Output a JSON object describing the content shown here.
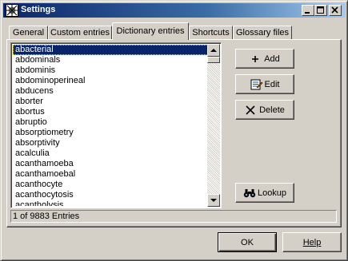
{
  "window": {
    "title": "Settings",
    "app_icon": "grid-app-icon"
  },
  "tabs": [
    {
      "label": "General",
      "active": false
    },
    {
      "label": "Custom entries",
      "active": false
    },
    {
      "label": "Dictionary entries",
      "active": true
    },
    {
      "label": "Shortcuts",
      "active": false
    },
    {
      "label": "Glossary files",
      "active": false
    }
  ],
  "entries": {
    "selected_index": 0,
    "items": [
      "abacterial",
      "abdominals",
      "abdominis",
      "abdominoperineal",
      "abducens",
      "aborter",
      "abortus",
      "abruptio",
      "absorptiometry",
      "absorptivity",
      "acalculia",
      "acanthamoeba",
      "acanthamoebal",
      "acanthocyte",
      "acanthocytosis",
      "acantholysis"
    ],
    "status": "1 of 9883 Entries"
  },
  "actions": {
    "add_label": "Add",
    "add_icon": "plus-icon",
    "edit_label": "Edit",
    "edit_icon": "edit-notepad-icon",
    "delete_label": "Delete",
    "delete_icon": "x-delete-icon",
    "lookup_label": "Lookup",
    "lookup_icon": "binoculars-icon"
  },
  "footer": {
    "ok_label": "OK",
    "help_label": "Help"
  },
  "colors": {
    "titlebar_start": "#0a246a",
    "titlebar_end": "#a6caf0",
    "selection": "#0a246a",
    "face": "#d4d0c8"
  }
}
